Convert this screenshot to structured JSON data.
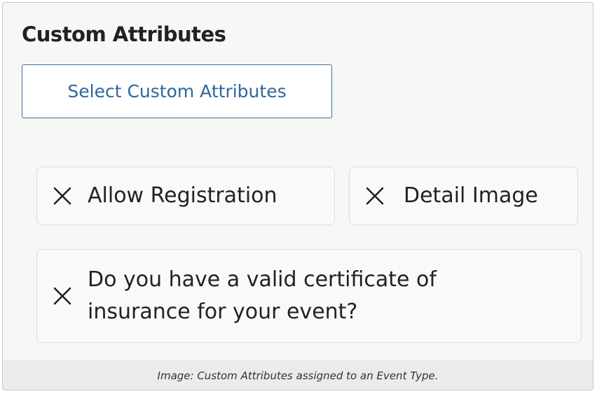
{
  "panel": {
    "title": "Custom Attributes",
    "select_button_label": "Select Custom Attributes"
  },
  "attributes": [
    {
      "label": "Allow Registration",
      "remove_icon": "close-icon"
    },
    {
      "label": "Detail Image",
      "remove_icon": "close-icon"
    },
    {
      "label": "Do you have a valid certificate of insurance for your event?",
      "remove_icon": "close-icon"
    }
  ],
  "caption": "Image: Custom Attributes assigned to an Event Type.",
  "colors": {
    "accent": "#2f679c",
    "panel_background": "#f7f7f5",
    "caption_background": "#ebebeb",
    "text": "#222222"
  }
}
